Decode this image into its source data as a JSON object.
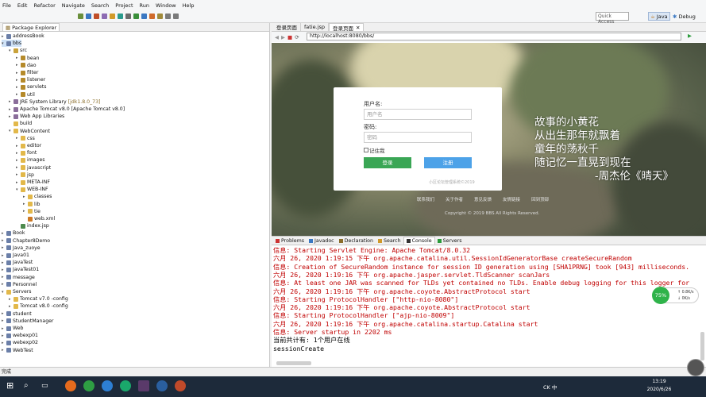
{
  "menu": [
    "File",
    "Edit",
    "Refactor",
    "Navigate",
    "Search",
    "Project",
    "Run",
    "Window",
    "Help"
  ],
  "toolbar": {
    "quick_access": "Quick Access",
    "persp_java": "Java",
    "persp_debug": "Debug"
  },
  "package_explorer": {
    "tab": "Package Explorer",
    "items": [
      {
        "label": "addressBook",
        "depth": 0,
        "arrow": "▸",
        "icon": "project-icon"
      },
      {
        "label": "bbs",
        "depth": 0,
        "arrow": "▾",
        "icon": "project-icon",
        "selected": true
      },
      {
        "label": "src",
        "depth": 1,
        "arrow": "▾",
        "icon": "source-folder-icon"
      },
      {
        "label": "bean",
        "depth": 2,
        "arrow": "▸",
        "icon": "package-icon"
      },
      {
        "label": "dao",
        "depth": 2,
        "arrow": "▸",
        "icon": "package-icon"
      },
      {
        "label": "filter",
        "depth": 2,
        "arrow": "▸",
        "icon": "package-icon"
      },
      {
        "label": "listener",
        "depth": 2,
        "arrow": "▸",
        "icon": "package-icon"
      },
      {
        "label": "servlets",
        "depth": 2,
        "arrow": "▸",
        "icon": "package-icon"
      },
      {
        "label": "util",
        "depth": 2,
        "arrow": "▸",
        "icon": "package-icon"
      },
      {
        "label": "JRE System Library",
        "extra": "[jdk1.8.0_73]",
        "depth": 1,
        "arrow": "▸",
        "icon": "library-icon"
      },
      {
        "label": "Apache Tomcat v8.0 [Apache Tomcat v8.0]",
        "depth": 1,
        "arrow": "▸",
        "icon": "library-icon"
      },
      {
        "label": "Web App Libraries",
        "depth": 1,
        "arrow": "▸",
        "icon": "library-icon"
      },
      {
        "label": "build",
        "depth": 1,
        "arrow": "",
        "icon": "folder-icon"
      },
      {
        "label": "WebContent",
        "depth": 1,
        "arrow": "▾",
        "icon": "folder-icon"
      },
      {
        "label": "css",
        "depth": 2,
        "arrow": "▸",
        "icon": "folder-icon"
      },
      {
        "label": "editor",
        "depth": 2,
        "arrow": "▸",
        "icon": "folder-icon"
      },
      {
        "label": "font",
        "depth": 2,
        "arrow": "▸",
        "icon": "folder-icon"
      },
      {
        "label": "images",
        "depth": 2,
        "arrow": "▸",
        "icon": "folder-icon"
      },
      {
        "label": "javascript",
        "depth": 2,
        "arrow": "▸",
        "icon": "folder-icon"
      },
      {
        "label": "jsp",
        "depth": 2,
        "arrow": "▸",
        "icon": "folder-icon"
      },
      {
        "label": "META-INF",
        "depth": 2,
        "arrow": "▸",
        "icon": "folder-icon"
      },
      {
        "label": "WEB-INF",
        "depth": 2,
        "arrow": "▾",
        "icon": "folder-icon"
      },
      {
        "label": "classes",
        "depth": 3,
        "arrow": "▸",
        "icon": "folder-icon"
      },
      {
        "label": "lib",
        "depth": 3,
        "arrow": "▸",
        "icon": "folder-icon"
      },
      {
        "label": "tie",
        "depth": 3,
        "arrow": "▸",
        "icon": "folder-icon"
      },
      {
        "label": "web.xml",
        "depth": 3,
        "arrow": "",
        "icon": "xml-file-icon"
      },
      {
        "label": "index.jsp",
        "depth": 2,
        "arrow": "",
        "icon": "jsp-file-icon"
      },
      {
        "label": "Book",
        "depth": 0,
        "arrow": "▸",
        "icon": "project-icon"
      },
      {
        "label": "Chapter8Demo",
        "depth": 0,
        "arrow": "▸",
        "icon": "project-icon"
      },
      {
        "label": "Java_zuoye",
        "depth": 0,
        "arrow": "▸",
        "icon": "project-icon"
      },
      {
        "label": "Java01",
        "depth": 0,
        "arrow": "▸",
        "icon": "project-icon"
      },
      {
        "label": "JavaTest",
        "depth": 0,
        "arrow": "▸",
        "icon": "project-icon"
      },
      {
        "label": "JavaTest01",
        "depth": 0,
        "arrow": "▸",
        "icon": "project-icon"
      },
      {
        "label": "message",
        "depth": 0,
        "arrow": "▸",
        "icon": "project-icon"
      },
      {
        "label": "Personnel",
        "depth": 0,
        "arrow": "▸",
        "icon": "project-icon"
      },
      {
        "label": "Servers",
        "depth": 0,
        "arrow": "▾",
        "icon": "folder-icon"
      },
      {
        "label": "Tomcat v7.0 -config",
        "depth": 1,
        "arrow": "▸",
        "icon": "folder-icon"
      },
      {
        "label": "Tomcat v8.0 -config",
        "depth": 1,
        "arrow": "▸",
        "icon": "folder-icon"
      },
      {
        "label": "student",
        "depth": 0,
        "arrow": "▸",
        "icon": "project-icon"
      },
      {
        "label": "StudentManager",
        "depth": 0,
        "arrow": "▸",
        "icon": "project-icon"
      },
      {
        "label": "Web",
        "depth": 0,
        "arrow": "▸",
        "icon": "project-icon"
      },
      {
        "label": "webexp01",
        "depth": 0,
        "arrow": "▸",
        "icon": "project-icon"
      },
      {
        "label": "webexp02",
        "depth": 0,
        "arrow": "▸",
        "icon": "project-icon"
      },
      {
        "label": "WebTest",
        "depth": 0,
        "arrow": "▸",
        "icon": "project-icon"
      }
    ]
  },
  "browser": {
    "tabs": [
      "登录页面",
      "fatie.jsp",
      "登录页面"
    ],
    "url": "http://localhost:8080/bbs/",
    "login": {
      "username_label": "用户名:",
      "username_placeholder": "用户名",
      "password_label": "密码:",
      "password_placeholder": "密码",
      "remember": "记住我",
      "login_button": "登录",
      "register_button": "注册",
      "copyright_inner": "小区论坛管理系统©2019"
    },
    "poem": [
      "故事的小黄花",
      "从出生那年就飘着",
      "童年的荡秋千",
      "随记忆一直晃到现在",
      "-周杰伦《晴天》"
    ],
    "footer_links": [
      "联系我们",
      "关于作者",
      "意见反馈",
      "友情链接",
      "回到顶部"
    ],
    "footer_copy": "Copyright © 2019 BBS All Rights Reserved."
  },
  "console": {
    "tabs": [
      "Problems",
      "Javadoc",
      "Declaration",
      "Search",
      "Console",
      "Servers"
    ],
    "active_tab": "Console",
    "lines": [
      {
        "text": "信息: Starting Servlet Engine: Apache Tomcat/8.0.32",
        "color": "red"
      },
      {
        "text": "六月 26, 2020 1:19:15 下午 org.apache.catalina.util.SessionIdGeneratorBase createSecureRandom",
        "color": "red"
      },
      {
        "text": "信息: Creation of SecureRandom instance for session ID generation using [SHA1PRNG] took [943] milliseconds.",
        "color": "red"
      },
      {
        "text": "六月 26, 2020 1:19:16 下午 org.apache.jasper.servlet.TldScanner scanJars",
        "color": "red"
      },
      {
        "text": "信息: At least one JAR was scanned for TLDs yet contained no TLDs. Enable debug logging for this logger for",
        "color": "red"
      },
      {
        "text": "六月 26, 2020 1:19:16 下午 org.apache.coyote.AbstractProtocol start",
        "color": "red"
      },
      {
        "text": "信息: Starting ProtocolHandler [\"http-nio-8080\"]",
        "color": "red"
      },
      {
        "text": "六月 26, 2020 1:19:16 下午 org.apache.coyote.AbstractProtocol start",
        "color": "red"
      },
      {
        "text": "信息: Starting ProtocolHandler [\"ajp-nio-8009\"]",
        "color": "red"
      },
      {
        "text": "六月 26, 2020 1:19:16 下午 org.apache.catalina.startup.Catalina start",
        "color": "red"
      },
      {
        "text": "信息: Server startup in 2202 ms",
        "color": "red"
      },
      {
        "text": "当前共计有: 1个用户在线",
        "color": "black"
      },
      {
        "text": "sessionCreate",
        "color": "black"
      }
    ]
  },
  "net_widget": {
    "percent": "75%",
    "up": "0.8K/s",
    "down": "0K/s"
  },
  "status": "完成",
  "taskbar": {
    "tray": "CK 中",
    "time": "13:19",
    "date": "2020/6/26"
  },
  "colors": {
    "login_green": "#3aa655",
    "register_blue": "#4da2e8",
    "console_red": "#c00000"
  }
}
